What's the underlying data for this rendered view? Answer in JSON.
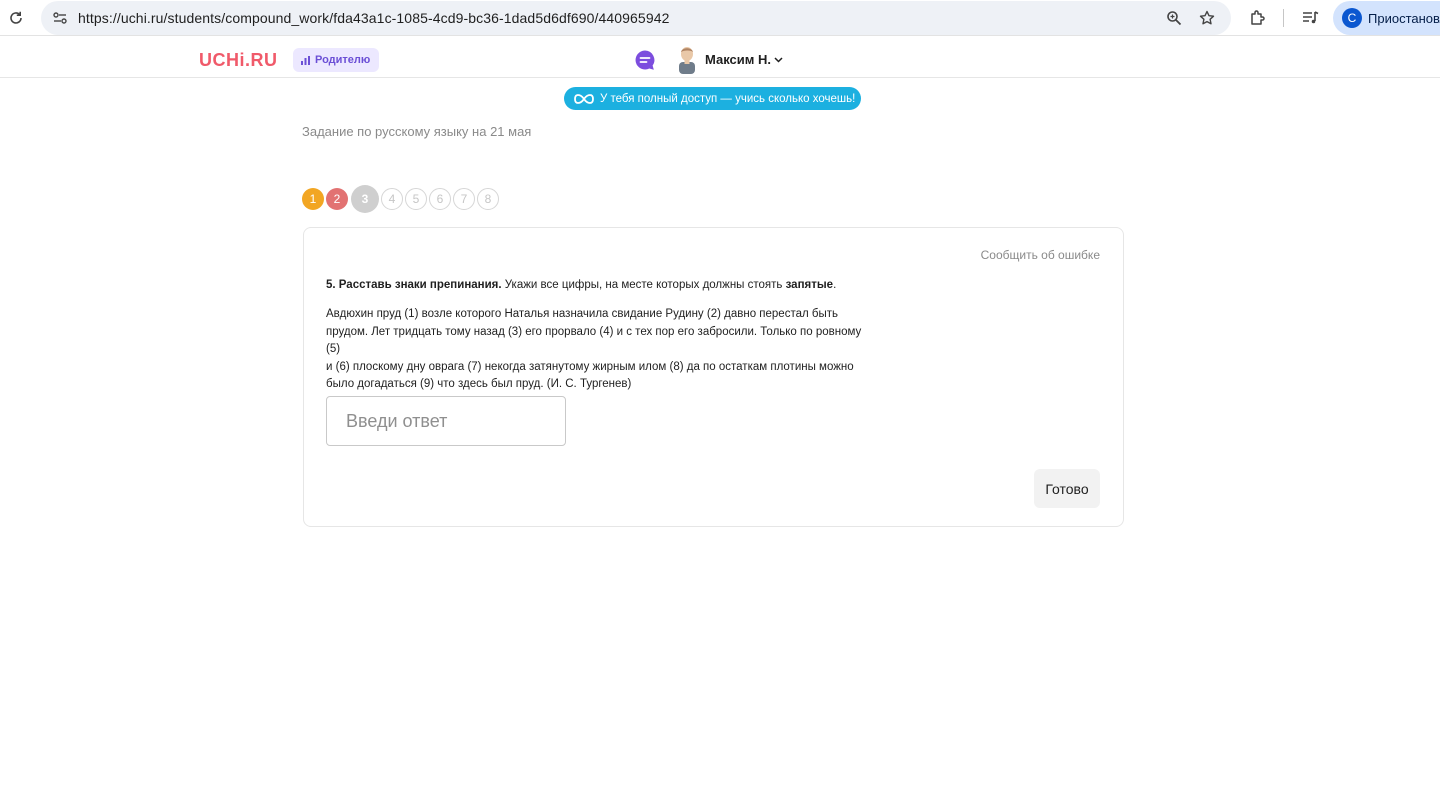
{
  "browser": {
    "url": "https://uchi.ru/students/compound_work/fda43a1c-1085-4cd9-bc36-1dad5d6df690/440965942",
    "profile_initial": "С",
    "profile_label": "Приостановлено"
  },
  "header": {
    "logo": "UCHi.RU",
    "parent_label": "Родителю",
    "user_name": "Максим Н."
  },
  "access_badge": "У тебя полный доступ — учись сколько хочешь!",
  "assignment_title": "Задание по русскому языку на 21 мая",
  "steps": [
    {
      "label": "1",
      "state": "done-yellow"
    },
    {
      "label": "2",
      "state": "done-red"
    },
    {
      "label": "3",
      "state": "current"
    },
    {
      "label": "4",
      "state": "todo"
    },
    {
      "label": "5",
      "state": "todo"
    },
    {
      "label": "6",
      "state": "todo"
    },
    {
      "label": "7",
      "state": "todo"
    },
    {
      "label": "8",
      "state": "todo"
    }
  ],
  "task": {
    "report_link": "Сообщить об ошибке",
    "heading_bold": "5. Расставь знаки препинания.",
    "heading_text": " Укажи все цифры, на месте которых должны стоять ",
    "heading_emph": "запятые",
    "heading_end": ".",
    "lines": [
      "Авдюхин пруд (1) возле которого Наталья назначила свидание Рудину (2) давно перестал быть",
      "прудом. Лет тридцать тому назад (3) его прорвало (4) и с тех пор его забросили. Только по ровному (5)",
      "и (6) плоскому дну оврага (7) некогда затянутому жирным илом (8) да по остаткам плотины можно",
      "было догадаться (9) что здесь был пруд. (И. С. Тургенев)"
    ],
    "answer_placeholder": "Введи ответ",
    "answer_value": "",
    "done_button": "Готово"
  },
  "colors": {
    "logo": "#f05a6a",
    "badge": "#1cb0e0",
    "step_yellow": "#f2a623",
    "step_red": "#e27272"
  }
}
